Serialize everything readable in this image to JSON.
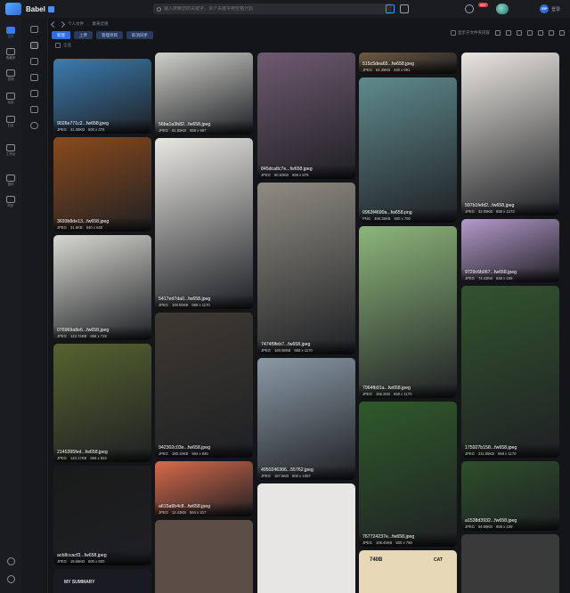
{
  "app": {
    "title": "Babel",
    "search_placeholder": "输入搜索您的关键字，多个关键字用空格分割",
    "login": "登录",
    "vip": "VIP",
    "notif": "99+"
  },
  "crumbs": [
    "个人文件",
    "素来灵感"
  ],
  "toolbar": {
    "new": "新建",
    "upload": "上传",
    "manage": "管理项目",
    "sync": "取消同步",
    "select_all": "全选",
    "show_sub": "显示子文件夹内容"
  },
  "rail": [
    {
      "label": "文件",
      "icon": "folder-icon"
    },
    {
      "label": "收藏夹",
      "icon": "bookmark-icon"
    },
    {
      "label": "发现",
      "icon": "discover-icon"
    },
    {
      "label": "动态",
      "icon": "activity-icon"
    },
    {
      "label": "日志",
      "icon": "log-icon"
    },
    {
      "label": "工作台",
      "icon": "workbench-icon"
    },
    {
      "label": "插件",
      "icon": "plugin-icon"
    },
    {
      "label": "同步",
      "icon": "sync-icon"
    }
  ],
  "cards": [
    {
      "name": "9026e771c2...fw658.jpeg",
      "type": "JPEG",
      "size": "41.39KB",
      "dim": "500 x 375",
      "bg": "#3b7cb0"
    },
    {
      "name": "3693b8de13...fw658.jpeg",
      "type": "JPEG",
      "size": "31.6KB",
      "dim": "640 x 640",
      "bg": "#8a4a1c"
    },
    {
      "name": "076969a8e6...fw658.jpeg",
      "type": "JPEG",
      "size": "123.74KB",
      "dim": "658 x 719",
      "bg": "#d8d8d2"
    },
    {
      "name": "2145395fed...fw658.jpeg",
      "type": "JPEG",
      "size": "140.17KB",
      "dim": "658 x 823",
      "bg": "#56632f"
    },
    {
      "name": "acb8ccacf3...fw658.jpeg",
      "type": "JPEG",
      "size": "19.66KB",
      "dim": "600 x 800",
      "bg": "#1a1a1a"
    },
    {
      "name": "56ba1a3b82...fw658.jpeg",
      "type": "JPEG",
      "size": "61.55KB",
      "dim": "658 x 987",
      "bg": "#cfcfca"
    },
    {
      "name": "5417ed7da0...fw658.jpeg",
      "type": "JPEG",
      "size": "100.55KB",
      "dim": "658 x 1170",
      "bg": "#e8e7e3"
    },
    {
      "name": "942302c03e...fw658.jpeg",
      "type": "JPEG",
      "size": "180.19KB",
      "dim": "584 x 846",
      "bg": "#3e3a32"
    },
    {
      "name": "a615a6b4c8...fw658.jpeg",
      "type": "JPEG",
      "size": "12.43KB",
      "dim": "564 x 317",
      "bg": "#d96a4a"
    },
    {
      "name": "845dca8c7e...fw658.jpeg",
      "type": "JPEG",
      "size": "60.63KB",
      "dim": "658 x 876",
      "bg": "#6e5a70"
    },
    {
      "name": "7474f9feb7...fw658.jpeg",
      "type": "JPEG",
      "size": "160.58KB",
      "dim": "658 x 1170",
      "bg": "#8e8c82"
    },
    {
      "name": "4950246306...55762.jpeg",
      "type": "JPEG",
      "size": "157.6KB",
      "dim": "800 x 1067",
      "bg": "#8b9aa6"
    },
    {
      "name": "515c5dea65...fw658.jpeg",
      "type": "JPEG",
      "size": "64.39KB",
      "dim": "440 x 691",
      "bg": "#6f5a40"
    },
    {
      "name": "0963f4690a...fw658.png",
      "type": "PNG",
      "size": "496.35KB",
      "dim": "500 x 750",
      "bg": "#5f8a8c"
    },
    {
      "name": "7964fb91a...fw658.jpeg",
      "type": "JPEG",
      "size": "155.2KB",
      "dim": "658 x 1170",
      "bg": "#8cb67a"
    },
    {
      "name": "767724237e...fw658.jpeg",
      "type": "JPEG",
      "size": "106.45KB",
      "dim": "500 x 750",
      "bg": "#2f5a2a"
    },
    {
      "name": "597b1fefd2...fw658.jpeg",
      "type": "JPEG",
      "size": "32.09KB",
      "dim": "658 x 1273",
      "bg": "#e9e6e0"
    },
    {
      "name": "9729c6b067...fw658.jpeg",
      "type": "JPEG",
      "size": "74.43KB",
      "dim": "658 x 439",
      "bg": "#b59acb"
    },
    {
      "name": "175927b158...fw658.jpeg",
      "type": "JPEG",
      "size": "211.55KB",
      "dim": "658 x 1170",
      "bg": "#32542e"
    },
    {
      "name": "a1538d3932...fw658.jpeg",
      "type": "JPEG",
      "size": "94.99KB",
      "dim": "658 x 439",
      "bg": "#2d4f2a"
    }
  ],
  "thumb_text": {
    "summary": "MY SUMMARY",
    "code": "740B",
    "cat": "CAT"
  }
}
